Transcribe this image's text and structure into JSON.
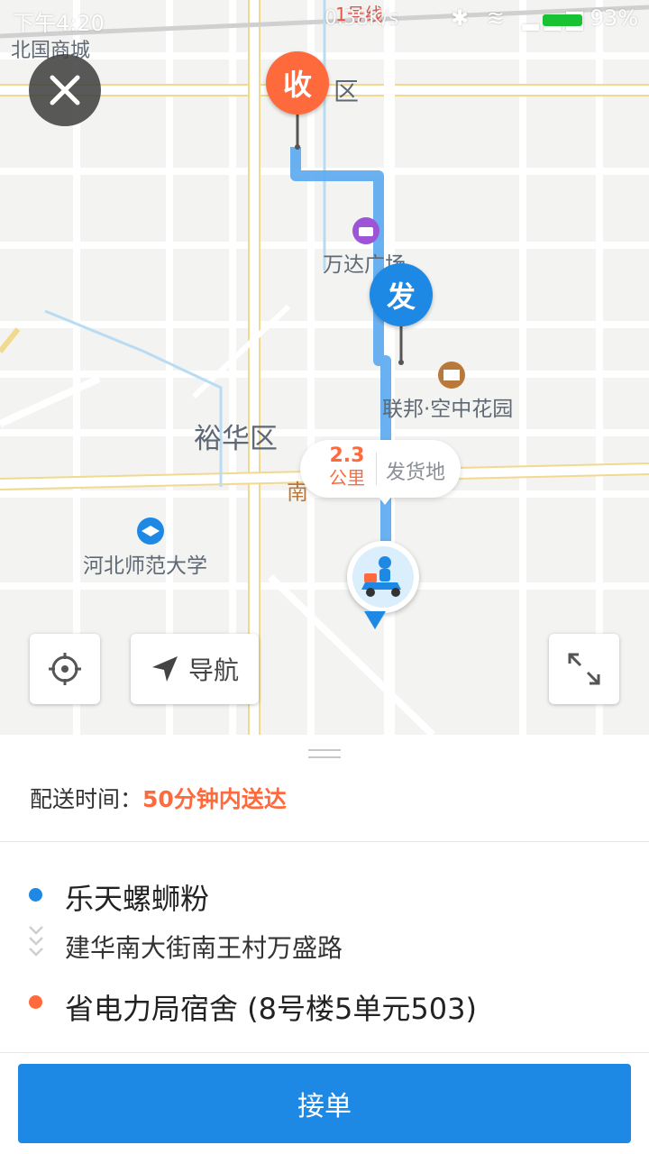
{
  "status_bar": {
    "time": "下午4:20",
    "speed": "0.38K/s",
    "battery": "93%"
  },
  "map": {
    "labels": {
      "mall": "北国商城",
      "metro": "1号线",
      "district_top": "区",
      "wanda": "万达广场",
      "lianbang": "联邦·空中花园",
      "yuhua": "裕华区",
      "nan": "南",
      "university": "河北师范大学"
    },
    "pin_receive": "收",
    "pin_send": "发",
    "distance_value": "2.3",
    "distance_unit": "公里",
    "distance_label": "发货地",
    "nav_label": "导航"
  },
  "order": {
    "delivery_time_label": "配送时间：",
    "delivery_time_value": "50分钟内送达",
    "shop_name": "乐天螺蛳粉",
    "shop_address": "建华南大街南王村万盛路",
    "destination": "省电力局宿舍 (8号楼5单元503)",
    "accept_label": "接单"
  },
  "colors": {
    "accent_blue": "#1e88e5",
    "accent_orange": "#ff6a3d"
  }
}
